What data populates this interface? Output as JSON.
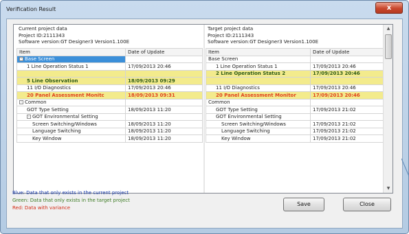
{
  "window": {
    "title": "Verification Result",
    "close_glyph": "x"
  },
  "left": {
    "header_lines": [
      "Current project data",
      "Project ID:2111343",
      "Software version:GT Designer3 Version1.100E"
    ],
    "columns": [
      "Item",
      "Date of Update"
    ],
    "rows": [
      {
        "item": "Base Screen",
        "date": "",
        "style": "selected",
        "indent": 0,
        "expander": "-"
      },
      {
        "item": "1 Line Operation Status 1",
        "date": "17/09/2013 20:46",
        "style": "",
        "indent": 1
      },
      {
        "item": "",
        "date": "",
        "style": "green",
        "indent": 1
      },
      {
        "item": "5 Line Observation",
        "date": "18/09/2013 09:29",
        "style": "green",
        "indent": 1
      },
      {
        "item": "11 I/O Diagnostics",
        "date": "17/09/2013 20:46",
        "style": "",
        "indent": 1
      },
      {
        "item": "20 Panel Assessment Monitc",
        "date": "18/09/2013 09:31",
        "style": "red",
        "indent": 1
      },
      {
        "item": "Common",
        "date": "",
        "style": "",
        "indent": 0,
        "expander": "-"
      },
      {
        "item": "GOT Type Setting",
        "date": "18/09/2013 11:20",
        "style": "",
        "indent": 1
      },
      {
        "item": "GOT Environmental Setting",
        "date": "",
        "style": "",
        "indent": 1,
        "expander": "-"
      },
      {
        "item": "Screen Switching/Windows",
        "date": "18/09/2013 11:20",
        "style": "",
        "indent": 2
      },
      {
        "item": "Language Switching",
        "date": "18/09/2013 11:20",
        "style": "",
        "indent": 2
      },
      {
        "item": "Key Window",
        "date": "18/09/2013 11:20",
        "style": "",
        "indent": 2
      }
    ]
  },
  "right": {
    "header_lines": [
      "Target project data",
      "Project ID:2111343",
      "Software version:GT Designer3 Version1.100E"
    ],
    "columns": [
      "Item",
      "Date of Update"
    ],
    "rows": [
      {
        "item": "Base Screen",
        "date": "",
        "style": "",
        "indent": 0
      },
      {
        "item": "1 Line Operation Status 1",
        "date": "17/09/2013 20:46",
        "style": "",
        "indent": 1
      },
      {
        "item": "2 Line Operation Status 2",
        "date": "17/09/2013 20:46",
        "style": "green",
        "indent": 1
      },
      {
        "item": "",
        "date": "",
        "style": "green",
        "indent": 1
      },
      {
        "item": "11 I/O Diagnostics",
        "date": "17/09/2013 20:46",
        "style": "",
        "indent": 1
      },
      {
        "item": "20 Panel Assessment Monitor",
        "date": "17/09/2013 20:46",
        "style": "red",
        "indent": 1
      },
      {
        "item": "Common",
        "date": "",
        "style": "",
        "indent": 0
      },
      {
        "item": "GOT Type Setting",
        "date": "17/09/2013 21:02",
        "style": "",
        "indent": 1
      },
      {
        "item": "GOT Environmental Setting",
        "date": "",
        "style": "",
        "indent": 1
      },
      {
        "item": "Screen Switching/Windows",
        "date": "17/09/2013 21:02",
        "style": "",
        "indent": 2
      },
      {
        "item": "Language Switching",
        "date": "17/09/2013 21:02",
        "style": "",
        "indent": 2
      },
      {
        "item": "Key Window",
        "date": "17/09/2013 21:02",
        "style": "",
        "indent": 2
      }
    ]
  },
  "legend": {
    "blue": "Blue: Data that only exists in the current project",
    "green": "Green: Data that only exists in the target project",
    "red": "Red: Data with variance"
  },
  "buttons": {
    "save": "Save",
    "close": "Close"
  },
  "colors": {
    "diff_highlight": "#f3eb8c",
    "selected": "#3b8fd9",
    "variance": "#e0401c"
  },
  "icons": {
    "scroll_up": "scroll-up-arrow-icon",
    "scroll_down": "scroll-down-arrow-icon",
    "expander": "collapse-toggle-icon"
  }
}
